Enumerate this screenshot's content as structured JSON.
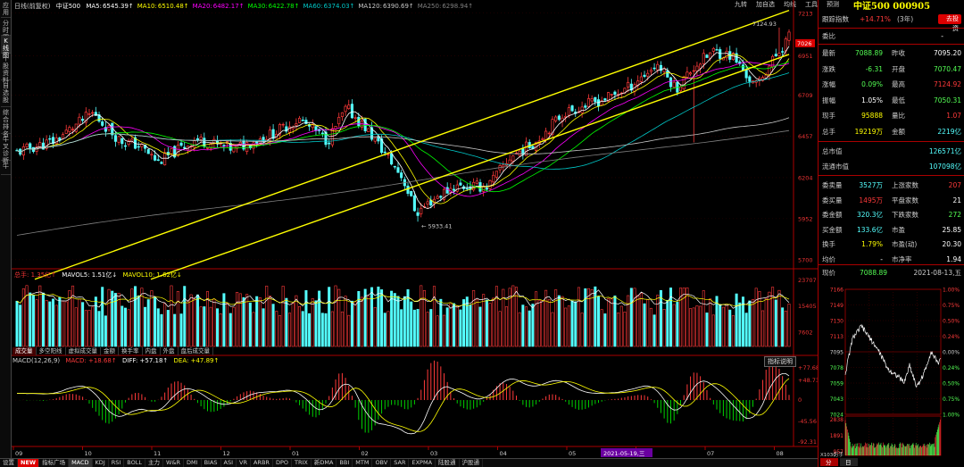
{
  "colors": {
    "up": "#ff3a3a",
    "down": "#54ffff",
    "ma5": "#ffffff",
    "ma10": "#ffff00",
    "ma20": "#ff00ff",
    "ma30": "#00ff00",
    "ma60": "#00c8c8",
    "ma120": "#c8c8c8",
    "ma250": "#808080",
    "channel": "#ffff00",
    "panel_border": "#aa0000",
    "accent": "#cc0000"
  },
  "left_tabs": [
    "应用",
    "分时图",
    "K线图",
    "个股资料",
    "自选股",
    "综合排名",
    "牛叉诊断",
    "牛"
  ],
  "top_icons": [
    "九转",
    "加自选",
    "均线",
    "工具",
    "预测"
  ],
  "price_header": {
    "label": "日线(前复权)",
    "name": "中证500",
    "ma": [
      {
        "label": "MA5:",
        "value": "6545.39↑",
        "color": "#ffffff"
      },
      {
        "label": "MA10:",
        "value": "6510.48↑",
        "color": "#ffff00"
      },
      {
        "label": "MA20:",
        "value": "6482.17↑",
        "color": "#ff00ff"
      },
      {
        "label": "MA30:",
        "value": "6422.78↑",
        "color": "#00ff00"
      },
      {
        "label": "MA60:",
        "value": "6374.03↑",
        "color": "#00c8c8"
      },
      {
        "label": "MA120:",
        "value": "6390.69↑",
        "color": "#c8c8c8"
      },
      {
        "label": "MA250:",
        "value": "6298.94↑",
        "color": "#808080"
      }
    ]
  },
  "price_axis": [
    "7213",
    "6951",
    "6709",
    "6457",
    "6204",
    "5952",
    "5700"
  ],
  "price_axis_highlight": "7026",
  "annotations": {
    "high": "7124.93",
    "low": "5933.41"
  },
  "vol_header": {
    "label": "总手: 1.35亿↑",
    "mavol5": "MAVOL5: 1.51亿↓",
    "mavol10": "MAVOL10: 1.62亿↓"
  },
  "vol_axis": [
    "23707",
    "15405",
    "7602"
  ],
  "vol_tabs": [
    "成交量",
    "多空阳线",
    "虚拟成交量",
    "金额",
    "换手率",
    "内盘",
    "外盘",
    "盘后成交量"
  ],
  "macd_header": {
    "label": "MACD(12,26,9)",
    "macd": "MACD: +18.68↑",
    "diff": "DIFF: +57.18↑",
    "dea": "DEA: +47.89↑"
  },
  "macd_button": "指标说明",
  "macd_axis": [
    "+77.68",
    "+48.73",
    "0",
    "-45.56",
    "-92.31"
  ],
  "months": [
    "09",
    "10",
    "11",
    "12",
    "01",
    "02",
    "03",
    "04",
    "05",
    "06",
    "07",
    "08"
  ],
  "date_highlight": "2021-05-19,三",
  "bottom_tabs": [
    "设置",
    "NEW",
    "指标广场",
    "MACD",
    "KDJ",
    "RSI",
    "BOLL",
    "主力",
    "W&R",
    "DMI",
    "BIAS",
    "ASI",
    "VR",
    "ARBR",
    "DPO",
    "TRIX",
    "新DMA",
    "BBI",
    "MTM",
    "OBV",
    "SAR",
    "EXPMA",
    "陆股通",
    "沪股通"
  ],
  "right_panel": {
    "title": "中证500 000905",
    "chip_label": "跟踪指数",
    "chip_value": "+14.71%",
    "chip_period": "(3年)",
    "chip_button": "去投资",
    "wb_label": "委比",
    "wb_value": "-",
    "quote_rows": [
      {
        "k1": "最新",
        "v1": "7088.89",
        "c1": "#54ff54",
        "k2": "昨收",
        "v2": "7095.20",
        "c2": "#ffffff"
      },
      {
        "k1": "涨跌",
        "v1": "-6.31",
        "c1": "#54ff54",
        "k2": "开盘",
        "v2": "7070.47",
        "c2": "#54ff54"
      },
      {
        "k1": "涨幅",
        "v1": "0.09%",
        "c1": "#54ff54",
        "k2": "最高",
        "v2": "7124.92",
        "c2": "#ff3a3a"
      },
      {
        "k1": "振幅",
        "v1": "1.05%",
        "c1": "#ffffff",
        "k2": "最低",
        "v2": "7050.31",
        "c2": "#54ff54"
      },
      {
        "k1": "现手",
        "v1": "95888",
        "c1": "#ffff00",
        "k2": "量比",
        "v2": "1.07",
        "c2": "#ff3a3a"
      },
      {
        "k1": "总手",
        "v1": "19219万",
        "c1": "#ffff00",
        "k2": "金额",
        "v2": "2219亿",
        "c2": "#54ffff"
      }
    ],
    "mv_rows": [
      {
        "k": "总市值",
        "v": "126571亿",
        "c": "#54ffff"
      },
      {
        "k": "流通市值",
        "v": "107098亿",
        "c": "#54ffff"
      }
    ],
    "breadth_rows": [
      {
        "k1": "委卖量",
        "v1": "3527万",
        "c1": "#54ffff",
        "k2": "上涨家数",
        "v2": "207",
        "c2": "#ff3a3a"
      },
      {
        "k1": "委买量",
        "v1": "1495万",
        "c1": "#ff3a3a",
        "k2": "平盘家数",
        "v2": "21",
        "c2": "#ffffff"
      },
      {
        "k1": "委金额",
        "v1": "320.3亿",
        "c1": "#54ffff",
        "k2": "下跌家数",
        "v2": "272",
        "c2": "#54ff54"
      },
      {
        "k1": "买金额",
        "v1": "133.6亿",
        "c1": "#54ffff",
        "k2": "市盈",
        "v2": "25.85",
        "c2": "#ffffff"
      },
      {
        "k1": "换手",
        "v1": "1.79%",
        "c1": "#ffff00",
        "k2": "市盈(动)",
        "v2": "20.30",
        "c2": "#ffffff"
      },
      {
        "k1": "均价",
        "v1": "-",
        "c1": "#ffffff",
        "k2": "市净率",
        "v2": "1.94",
        "c2": "#ffffff"
      }
    ],
    "intraday": {
      "label": "现价",
      "value": "7088.89",
      "date": "2021-08-13,五",
      "left_axis": [
        "7166",
        "7149",
        "7130",
        "7113",
        "7095",
        "7078",
        "7059",
        "7043",
        "7024"
      ],
      "right_axis": [
        "1.00%",
        "0.75%",
        "0.50%",
        "0.24%",
        "0.00%",
        "0.24%",
        "0.50%",
        "0.75%",
        "1.00%"
      ],
      "vol_axis": [
        "2838",
        "1891",
        "957"
      ],
      "bottom_left": "万手",
      "bottom_label": "X1030",
      "tabs": [
        "分",
        "日"
      ]
    }
  }
}
